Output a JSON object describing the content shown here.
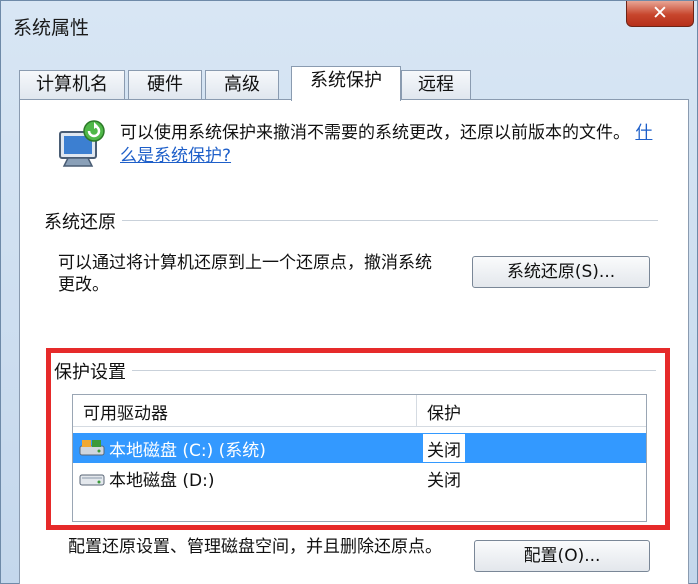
{
  "window": {
    "title": "系统属性",
    "close_label": "✕"
  },
  "tabs": [
    {
      "label": "计算机名",
      "active": false
    },
    {
      "label": "硬件",
      "active": false
    },
    {
      "label": "高级",
      "active": false
    },
    {
      "label": "系统保护",
      "active": true
    },
    {
      "label": "远程",
      "active": false
    }
  ],
  "intro": {
    "text": "可以使用系统保护来撤消不需要的系统更改，还原以前版本的文件。",
    "link": "什么是系统保护?"
  },
  "restore": {
    "group_label": "系统还原",
    "description": "可以通过将计算机还原到上一个还原点，撤消系统更改。",
    "button_label": "系统还原(S)..."
  },
  "protection": {
    "group_label": "保护设置",
    "columns": [
      "可用驱动器",
      "保护"
    ],
    "drives": [
      {
        "name": "本地磁盘 (C:) (系统)",
        "protection": "关闭",
        "selected": true,
        "icon": "system-drive-icon"
      },
      {
        "name": "本地磁盘 (D:)",
        "protection": "关闭",
        "selected": false,
        "icon": "hard-drive-icon"
      }
    ],
    "configure_description": "配置还原设置、管理磁盘空间，并且删除还原点。",
    "configure_button_label": "配置(O)..."
  },
  "colors": {
    "selection": "#3399ff",
    "highlight_box": "#e62a2a",
    "link": "#1e5fc9"
  }
}
